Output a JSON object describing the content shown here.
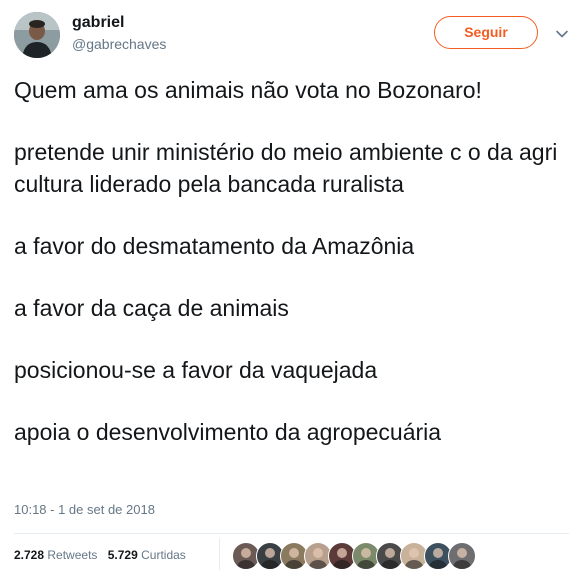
{
  "user": {
    "name": "gabriel",
    "handle": "@gabrechaves"
  },
  "follow_button": {
    "label": "Seguir"
  },
  "tweet": {
    "lines": [
      "Quem ama os animais não vota no Bozonaro!",
      "pretende unir ministério do meio ambiente c o da agricultura liderado pela bancada ruralista",
      "a favor do desmatamento da Amazônia",
      "a favor da caça de animais",
      "posicionou-se a favor da vaquejada",
      "apoia o desenvolvimento da agropecuária"
    ],
    "timestamp": "10:18 - 1 de set de 2018"
  },
  "stats": {
    "retweets_count": "2.728",
    "retweets_label": "Retweets",
    "likes_count": "5.729",
    "likes_label": "Curtidas"
  },
  "colors": {
    "accent": "#f45d22",
    "text": "#14171a",
    "secondary": "#657786",
    "divider": "#e6ecf0"
  },
  "icons": {
    "caret": "chevron-down-icon"
  },
  "likers": [
    {
      "name": "liker-avatar-1",
      "bg": "#6b5a55"
    },
    {
      "name": "liker-avatar-2",
      "bg": "#3a3f44"
    },
    {
      "name": "liker-avatar-3",
      "bg": "#8a7a60"
    },
    {
      "name": "liker-avatar-4",
      "bg": "#b7a08d"
    },
    {
      "name": "liker-avatar-5",
      "bg": "#5c3a3a"
    },
    {
      "name": "liker-avatar-6",
      "bg": "#7a8a6a"
    },
    {
      "name": "liker-avatar-7",
      "bg": "#4a4a4a"
    },
    {
      "name": "liker-avatar-8",
      "bg": "#c8b29a"
    },
    {
      "name": "liker-avatar-9",
      "bg": "#3d5060"
    },
    {
      "name": "liker-avatar-10",
      "bg": "#6e6e70"
    }
  ]
}
